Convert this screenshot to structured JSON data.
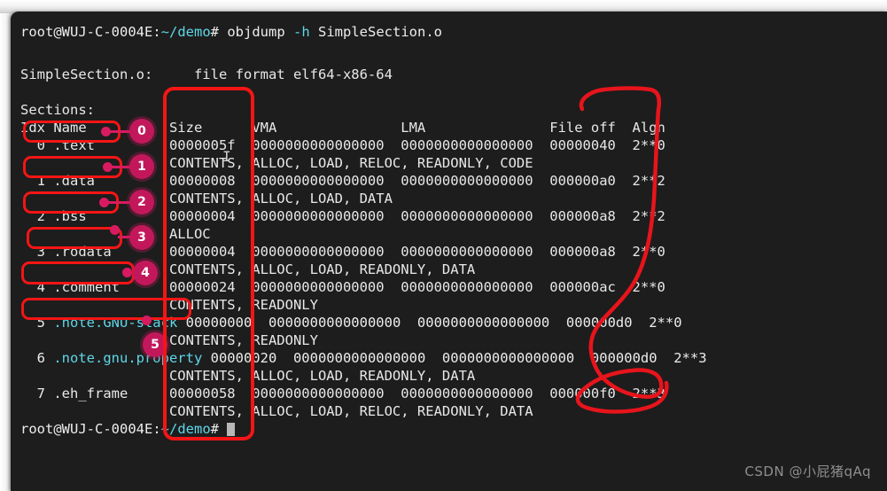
{
  "terminal": {
    "prompt_user_host": "root@WUJ-C-0004E",
    "prompt_sep": ":",
    "prompt_path": "~/demo",
    "prompt_tail": "# ",
    "command": "objdump -h SimpleSection.o",
    "command_cmd": "objdump",
    "command_flag": "-h",
    "command_arg": "SimpleSection.o",
    "file_header": "SimpleSection.o:     file format elf64-x86-64",
    "sections_label": "Sections:",
    "columns": "Idx Name          Size      VMA               LMA               File off  Algn",
    "columns_parts": {
      "idx": "Idx",
      "name": "Name",
      "size": "Size",
      "vma": "VMA",
      "lma": "LMA",
      "file_off": "File off",
      "algn": "Algn"
    },
    "rows": [
      {
        "idx": "0",
        "name": ".text",
        "size": "0000005f",
        "vma": "0000000000000000",
        "lma": "0000000000000000",
        "file_off": "00000040",
        "algn": "2**0",
        "flags": "CONTENTS, ALLOC, LOAD, RELOC, READONLY, CODE",
        "line1": "  0 .text         0000005f  0000000000000000  0000000000000000  00000040  2**0",
        "line2": "                  CONTENTS, ALLOC, LOAD, RELOC, READONLY, CODE"
      },
      {
        "idx": "1",
        "name": ".data",
        "size": "00000008",
        "vma": "0000000000000000",
        "lma": "0000000000000000",
        "file_off": "000000a0",
        "algn": "2**2",
        "flags": "CONTENTS, ALLOC, LOAD, DATA",
        "line1": "  1 .data         00000008  0000000000000000  0000000000000000  000000a0  2**2",
        "line2": "                  CONTENTS, ALLOC, LOAD, DATA"
      },
      {
        "idx": "2",
        "name": ".bss",
        "size": "00000004",
        "vma": "0000000000000000",
        "lma": "0000000000000000",
        "file_off": "000000a8",
        "algn": "2**2",
        "flags": "ALLOC",
        "line1": "  2 .bss          00000004  0000000000000000  0000000000000000  000000a8  2**2",
        "line2": "                  ALLOC"
      },
      {
        "idx": "3",
        "name": ".rodata",
        "size": "00000004",
        "vma": "0000000000000000",
        "lma": "0000000000000000",
        "file_off": "000000a8",
        "algn": "2**0",
        "flags": "CONTENTS, ALLOC, LOAD, READONLY, DATA",
        "line1": "  3 .rodata       00000004  0000000000000000  0000000000000000  000000a8  2**0",
        "line2": "                  CONTENTS, ALLOC, LOAD, READONLY, DATA"
      },
      {
        "idx": "4",
        "name": ".comment",
        "size": "00000024",
        "vma": "0000000000000000",
        "lma": "0000000000000000",
        "file_off": "000000ac",
        "algn": "2**0",
        "flags": "CONTENTS, READONLY",
        "line1": "  4 .comment      00000024  0000000000000000  0000000000000000  000000ac  2**0",
        "line2": "                  CONTENTS, READONLY"
      },
      {
        "idx": "5",
        "name": ".note.GNU-stack",
        "size": "00000000",
        "vma": "0000000000000000",
        "lma": "0000000000000000",
        "file_off": "000000d0",
        "algn": "2**0",
        "flags": "CONTENTS, READONLY",
        "line1_pre": "  5 ",
        "line1_name": ".note.GNU-stack",
        "line1_post": " 00000000  0000000000000000  0000000000000000  000000d0  2**0",
        "line2": "                  CONTENTS, READONLY"
      },
      {
        "idx": "6",
        "name": ".note.gnu.property",
        "size": "00000020",
        "vma": "0000000000000000",
        "lma": "0000000000000000",
        "file_off": "000000d0",
        "algn": "2**3",
        "flags": "CONTENTS, ALLOC, LOAD, READONLY, DATA",
        "line1_pre": "  6 ",
        "line1_name": ".note.gnu.property",
        "line1_post": " 00000020  0000000000000000  0000000000000000  000000d0  2**3",
        "line2": "                  CONTENTS, ALLOC, LOAD, READONLY, DATA"
      },
      {
        "idx": "7",
        "name": ".eh_frame",
        "size": "00000058",
        "vma": "0000000000000000",
        "lma": "0000000000000000",
        "file_off": "000000f0",
        "algn": "2**3",
        "flags": "CONTENTS, ALLOC, LOAD, RELOC, READONLY, DATA",
        "line1": "  7 .eh_frame     00000058  0000000000000000  0000000000000000  000000f0  2**3",
        "line2": "                  CONTENTS, ALLOC, LOAD, RELOC, READONLY, DATA"
      }
    ]
  },
  "annotations": {
    "badges": [
      "0",
      "1",
      "2",
      "3",
      "4",
      "5"
    ],
    "box_color": "#f51515",
    "badge_color": "#c2185b"
  },
  "watermark": {
    "text": "CSDN @小屁猪qAq"
  }
}
